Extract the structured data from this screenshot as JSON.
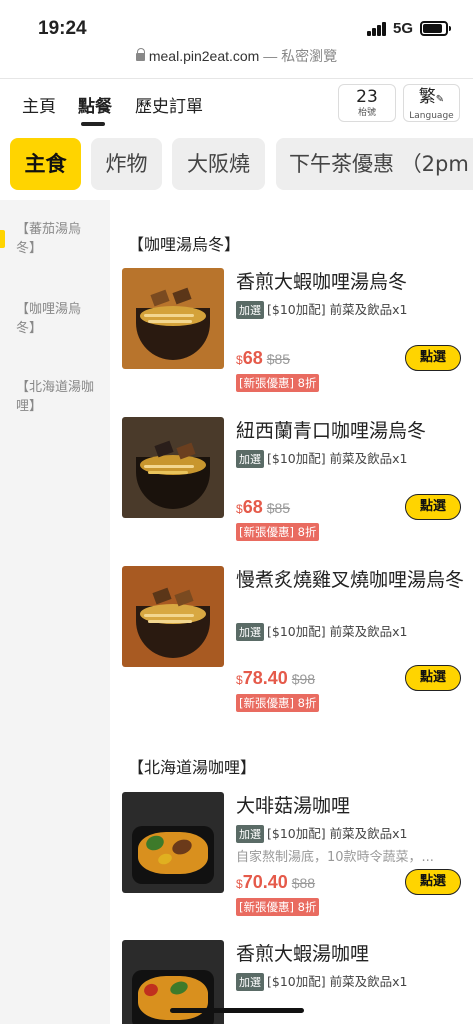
{
  "status_bar": {
    "time": "19:24",
    "network": "5G"
  },
  "browser": {
    "url": "meal.pin2eat.com",
    "private_label": "— 私密瀏覽"
  },
  "nav": {
    "tabs": [
      {
        "label": "主頁",
        "active": false
      },
      {
        "label": "點餐",
        "active": true
      },
      {
        "label": "歷史訂單",
        "active": false
      }
    ],
    "table_number": "23",
    "table_label": "枱號",
    "language_char": "繁",
    "language_label": "Language"
  },
  "categories": [
    {
      "label": "主食",
      "active": true
    },
    {
      "label": "炸物",
      "active": false
    },
    {
      "label": "大阪燒",
      "active": false
    },
    {
      "label": "下午茶優惠 （2pm",
      "active": false
    }
  ],
  "sidebar": {
    "items": [
      {
        "label": "【蕃茄湯烏冬】",
        "active": true
      },
      {
        "label": "【咖哩湯烏冬】",
        "active": false
      },
      {
        "label": "【北海道湯咖哩】",
        "active": false
      }
    ]
  },
  "sections": [
    {
      "title": "【咖哩湯烏冬】",
      "items": [
        {
          "name": "香煎大蝦咖哩湯烏冬",
          "addon_tag": "加選",
          "addon_text": "[$10加配] 前菜及飲品x1",
          "currency": "$",
          "price": "68",
          "original_price": "$85",
          "promo": "[新張優惠] 8折",
          "button": "點選"
        },
        {
          "name": "紐西蘭青口咖哩湯烏冬",
          "addon_tag": "加選",
          "addon_text": "[$10加配] 前菜及飲品x1",
          "currency": "$",
          "price": "68",
          "original_price": "$85",
          "promo": "[新張優惠] 8折",
          "button": "點選"
        },
        {
          "name": "慢煮炙燒雞叉燒咖哩湯烏冬",
          "addon_tag": "加選",
          "addon_text": "[$10加配] 前菜及飲品x1",
          "currency": "$",
          "price": "78.40",
          "original_price": "$98",
          "promo": "[新張優惠] 8折",
          "button": "點選"
        }
      ]
    },
    {
      "title": "【北海道湯咖哩】",
      "items": [
        {
          "name": "大啡菇湯咖哩",
          "addon_tag": "加選",
          "addon_text": "[$10加配] 前菜及飲品x1",
          "description": "自家熬制湯底，10款時令蔬菜，...",
          "currency": "$",
          "price": "70.40",
          "original_price": "$88",
          "promo": "[新張優惠] 8折",
          "button": "點選"
        },
        {
          "name": "香煎大蝦湯咖哩",
          "addon_tag": "加選",
          "addon_text": "[$10加配] 前菜及飲品x1"
        }
      ]
    }
  ],
  "colors": {
    "accent": "#ffd400",
    "price": "#e55a4a",
    "promo_bg": "#e96b60",
    "tag_bg": "#5a6b66"
  }
}
